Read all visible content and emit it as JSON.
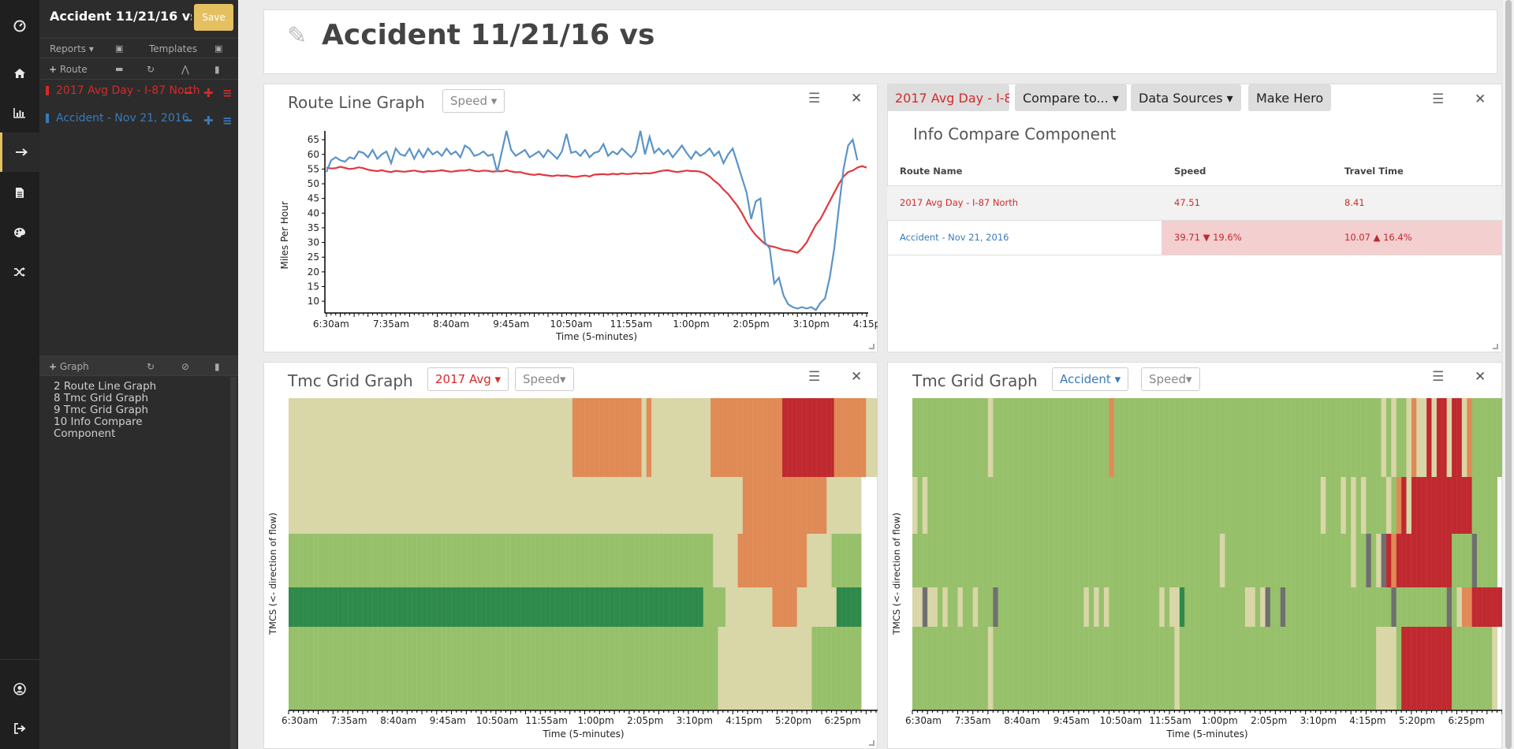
{
  "sidebar": {
    "title": "Accident 11/21/16 vs AvgDay",
    "save_label": "Save",
    "reports_label": "Reports",
    "templates_label": "Templates",
    "route_label": "Route",
    "graph_label": "Graph",
    "routes": [
      {
        "name": "2017 Avg Day - I-87 North",
        "color": "#d42a2a"
      },
      {
        "name": "Accident - Nov 21, 2016",
        "color": "#3a7ab9"
      }
    ],
    "graphs": [
      "2 Route Line Graph",
      "8 Tmc Grid Graph",
      "9 Tmc Grid Graph",
      "10 Info Compare Component"
    ]
  },
  "rail_icons": [
    "dashboard-icon",
    "home-icon",
    "bar-chart-icon",
    "arrow-right-icon",
    "file-icon",
    "palette-icon",
    "shuffle-icon",
    "user-icon",
    "sign-out-icon"
  ],
  "page": {
    "title": "Accident 11/21/16 vs AvgDay"
  },
  "route_line_graph": {
    "title": "Route Line Graph",
    "metric_label": "Speed"
  },
  "info_compare": {
    "title": "Info Compare Component",
    "tab_label": "2017 Avg Day - I-87 North",
    "compare_label": "Compare to...",
    "sources_label": "Data Sources",
    "hero_label": "Make Hero",
    "columns": [
      "Route Name",
      "Speed",
      "Travel Time"
    ],
    "rows": [
      {
        "name": "2017 Avg Day - I-87 North",
        "speed": "47.51",
        "speed_delta": "",
        "tt": "8.41",
        "tt_delta": ""
      },
      {
        "name": "Accident - Nov 21, 2016",
        "speed": "39.71",
        "speed_delta": "19.6%",
        "tt": "10.07",
        "tt_delta": "16.4%"
      }
    ]
  },
  "tmc_left": {
    "title": "Tmc Grid Graph",
    "route_label": "2017 Avg",
    "metric_label": "Speed"
  },
  "tmc_right": {
    "title": "Tmc Grid Graph",
    "route_label": "Accident",
    "metric_label": "Speed"
  },
  "chart_data": [
    {
      "type": "line",
      "title": "",
      "xlabel": "Time (5-minutes)",
      "ylabel": "Miles Per Hour",
      "ylim": [
        6,
        68
      ],
      "yticks": [
        10,
        15,
        20,
        25,
        30,
        35,
        40,
        45,
        50,
        55,
        60,
        65
      ],
      "x_tick_labels": [
        "6:30am",
        "7:35am",
        "8:40am",
        "9:45am",
        "10:50am",
        "11:55am",
        "1:00pm",
        "2:05pm",
        "3:10pm",
        "4:15pm",
        "5:20pm",
        "6:25pm"
      ],
      "x_start_minutes": 360,
      "x_interval_minutes": 5,
      "series": [
        {
          "name": "2017 Avg Day - I-87 North",
          "color": "#e0383f",
          "values": [
            55.5,
            55.2,
            55.3,
            55.8,
            55.4,
            55.0,
            55.2,
            55.6,
            55.3,
            54.8,
            54.5,
            54.3,
            54.6,
            54.2,
            54.0,
            54.4,
            54.2,
            54.1,
            54.3,
            54.5,
            54.2,
            54.0,
            54.3,
            54.2,
            54.4,
            54.6,
            54.3,
            54.1,
            54.3,
            54.5,
            54.5,
            54.8,
            54.4,
            54.2,
            54.5,
            54.4,
            54.1,
            54.3,
            54.2,
            54.6,
            54.2,
            53.9,
            54.0,
            53.5,
            53.2,
            53.0,
            53.3,
            53.0,
            52.8,
            52.6,
            52.9,
            52.7,
            52.8,
            52.5,
            52.3,
            52.6,
            52.8,
            52.5,
            53.1,
            53.2,
            53.3,
            53.1,
            53.4,
            53.2,
            53.5,
            53.3,
            53.4,
            53.6,
            53.4,
            53.6,
            53.5,
            53.8,
            54.2,
            54.5,
            54.6,
            54.2,
            54.0,
            54.2,
            54.5,
            54.3,
            54.3,
            54.1,
            53.5,
            52.5,
            51.0,
            49.8,
            48.0,
            46.5,
            44.5,
            42.5,
            40.0,
            37.0,
            34.5,
            32.5,
            31.0,
            29.5,
            28.8,
            28.5,
            28.0,
            27.5,
            27.3,
            27.0,
            26.5,
            28.0,
            30.0,
            33.0,
            36.0,
            38.0,
            41.0,
            44.0,
            47.0,
            50.0,
            52.5,
            54.0,
            54.5,
            55.5,
            56.0,
            55.5
          ]
        },
        {
          "name": "Accident - Nov 21, 2016",
          "color": "#5b94c8",
          "values": [
            54.0,
            58.0,
            59.0,
            58.0,
            57.5,
            59.0,
            58.5,
            61.0,
            60.5,
            59.0,
            61.5,
            58.5,
            60.0,
            61.0,
            57.0,
            62.0,
            60.0,
            59.5,
            62.0,
            58.5,
            61.5,
            59.0,
            62.0,
            60.0,
            61.0,
            59.5,
            62.0,
            60.0,
            61.0,
            59.0,
            63.0,
            62.0,
            59.5,
            60.0,
            61.0,
            59.5,
            60.0,
            54.0,
            61.0,
            68.0,
            61.5,
            59.5,
            60.5,
            61.5,
            59.0,
            60.0,
            61.0,
            59.0,
            61.5,
            60.0,
            58.5,
            61.0,
            67.0,
            60.5,
            61.0,
            59.5,
            61.5,
            59.0,
            60.5,
            61.0,
            63.5,
            59.5,
            61.0,
            60.0,
            62.0,
            60.5,
            59.0,
            61.0,
            68.0,
            60.0,
            66.0,
            60.5,
            62.0,
            60.0,
            61.5,
            59.0,
            61.0,
            63.0,
            60.5,
            58.5,
            61.0,
            59.5,
            60.5,
            62.0,
            59.5,
            61.0,
            57.0,
            60.0,
            62.0,
            57.0,
            52.0,
            47.0,
            38.0,
            44.0,
            45.0,
            30.0,
            28.0,
            16.0,
            18.0,
            12.0,
            9.0,
            8.0,
            7.5,
            8.0,
            7.5,
            8.0,
            7.0,
            9.5,
            11.0,
            18.0,
            28.0,
            42.0,
            55.0,
            63.0,
            65.0,
            58.0
          ]
        }
      ]
    },
    {
      "type": "heatmap",
      "title": "",
      "xlabel": "Time (5-minutes)",
      "ylabel": "TMCS (<- direction of flow)",
      "x_tick_labels": [
        "6:30am",
        "7:35am",
        "8:40am",
        "9:45am",
        "10:50am",
        "11:55am",
        "1:00pm",
        "2:05pm",
        "3:10pm",
        "4:15pm",
        "5:20pm",
        "6:25pm"
      ],
      "palette": {
        "k": "#6f6f6f",
        "d": "#2e8a4a",
        "g": "#97c06a",
        "y": "#d9d6a8",
        "o": "#e08a55",
        "r": "#c0292f"
      },
      "rows": [
        {
          "height": 1.0,
          "segments": [
            [
              "y",
              57.5
            ],
            [
              "o",
              14
            ],
            [
              "y",
              1
            ],
            [
              "o",
              1
            ],
            [
              "y",
              12
            ],
            [
              "o",
              14.5
            ],
            [
              "r",
              10.5
            ],
            [
              "o",
              6.5
            ],
            [
              "y",
              2.5
            ]
          ]
        },
        {
          "height": 0.72,
          "segments": [
            [
              "y",
              92
            ],
            [
              "o",
              17
            ],
            [
              "y",
              7
            ]
          ]
        },
        {
          "height": 0.68,
          "segments": [
            [
              "g",
              86
            ],
            [
              "y",
              5
            ],
            [
              "o",
              14
            ],
            [
              "y",
              5
            ],
            [
              "g",
              6
            ]
          ]
        },
        {
          "height": 0.5,
          "segments": [
            [
              "d",
              84
            ],
            [
              "g",
              4.5
            ],
            [
              "y",
              9.5
            ],
            [
              "o",
              5
            ],
            [
              "y",
              8
            ],
            [
              "d",
              5
            ]
          ]
        },
        {
          "height": 1.05,
          "segments": [
            [
              "g",
              87
            ],
            [
              "y",
              19
            ],
            [
              "g",
              10
            ]
          ]
        }
      ]
    },
    {
      "type": "heatmap",
      "title": "",
      "xlabel": "Time (5-minutes)",
      "ylabel": "TMCS (<- direction of flow)",
      "x_tick_labels": [
        "6:30am",
        "7:35am",
        "8:40am",
        "9:45am",
        "10:50am",
        "11:55am",
        "1:00pm",
        "2:05pm",
        "3:10pm",
        "4:15pm",
        "5:20pm",
        "6:25pm"
      ],
      "palette": {
        "k": "#6f6f6f",
        "d": "#2e8a4a",
        "g": "#97c06a",
        "y": "#d9d6a8",
        "o": "#e08a55",
        "r": "#c0292f"
      },
      "rows": [
        {
          "height": 1.0,
          "segments": [
            [
              "g",
              15
            ],
            [
              "y",
              1
            ],
            [
              "g",
              23
            ],
            [
              "o",
              1
            ],
            [
              "g",
              53
            ],
            [
              "y",
              1
            ],
            [
              "g",
              1
            ],
            [
              "y",
              1
            ],
            [
              "g",
              2
            ],
            [
              "y",
              1
            ],
            [
              "o",
              1
            ],
            [
              "y",
              2
            ],
            [
              "r",
              1
            ],
            [
              "y",
              1
            ],
            [
              "r",
              2
            ],
            [
              "y",
              1
            ],
            [
              "r",
              2
            ],
            [
              "y",
              1
            ],
            [
              "o",
              1
            ],
            [
              "g",
              6
            ]
          ]
        },
        {
          "height": 0.72,
          "segments": [
            [
              "y",
              1
            ],
            [
              "g",
              1
            ],
            [
              "y",
              1
            ],
            [
              "g",
              78
            ],
            [
              "y",
              1
            ],
            [
              "g",
              3
            ],
            [
              "y",
              1
            ],
            [
              "g",
              1
            ],
            [
              "y",
              1
            ],
            [
              "g",
              1
            ],
            [
              "y",
              1
            ],
            [
              "g",
              4
            ],
            [
              "y",
              1
            ],
            [
              "g",
              1
            ],
            [
              "o",
              1
            ],
            [
              "r",
              1
            ],
            [
              "y",
              1
            ],
            [
              "r",
              12
            ],
            [
              "g",
              5
            ]
          ]
        },
        {
          "height": 0.68,
          "segments": [
            [
              "g",
              61
            ],
            [
              "y",
              1
            ],
            [
              "g",
              25
            ],
            [
              "y",
              1
            ],
            [
              "g",
              2
            ],
            [
              "k",
              1
            ],
            [
              "g",
              1
            ],
            [
              "y",
              1
            ],
            [
              "k",
              1
            ],
            [
              "r",
              1
            ],
            [
              "o",
              1
            ],
            [
              "r",
              11
            ],
            [
              "g",
              4
            ],
            [
              "k",
              1
            ],
            [
              "g",
              4
            ]
          ]
        },
        {
          "height": 0.5,
          "segments": [
            [
              "y",
              2
            ],
            [
              "k",
              1
            ],
            [
              "y",
              2
            ],
            [
              "g",
              1
            ],
            [
              "y",
              1
            ],
            [
              "g",
              2
            ],
            [
              "y",
              1
            ],
            [
              "g",
              2
            ],
            [
              "y",
              1
            ],
            [
              "g",
              3
            ],
            [
              "k",
              1
            ],
            [
              "g",
              17
            ],
            [
              "y",
              1
            ],
            [
              "g",
              1
            ],
            [
              "y",
              1
            ],
            [
              "g",
              1
            ],
            [
              "y",
              1
            ],
            [
              "g",
              10
            ],
            [
              "y",
              1
            ],
            [
              "g",
              1
            ],
            [
              "y",
              2
            ],
            [
              "d",
              1
            ],
            [
              "g",
              12
            ],
            [
              "y",
              2
            ],
            [
              "g",
              1
            ],
            [
              "y",
              1
            ],
            [
              "k",
              1
            ],
            [
              "g",
              2
            ],
            [
              "k",
              1
            ],
            [
              "g",
              21
            ],
            [
              "k",
              1
            ],
            [
              "g",
              10
            ],
            [
              "k",
              1
            ],
            [
              "g",
              1
            ],
            [
              "y",
              1
            ],
            [
              "o",
              2
            ],
            [
              "r",
              10
            ],
            [
              "o",
              1
            ],
            [
              "g",
              2
            ],
            [
              "k",
              1
            ]
          ]
        },
        {
          "height": 1.05,
          "segments": [
            [
              "g",
              15
            ],
            [
              "y",
              1
            ],
            [
              "g",
              36
            ],
            [
              "y",
              1
            ],
            [
              "g",
              39
            ],
            [
              "y",
              4
            ],
            [
              "g",
              1
            ],
            [
              "r",
              10
            ],
            [
              "g",
              8
            ],
            [
              "y",
              1
            ]
          ]
        }
      ]
    }
  ]
}
